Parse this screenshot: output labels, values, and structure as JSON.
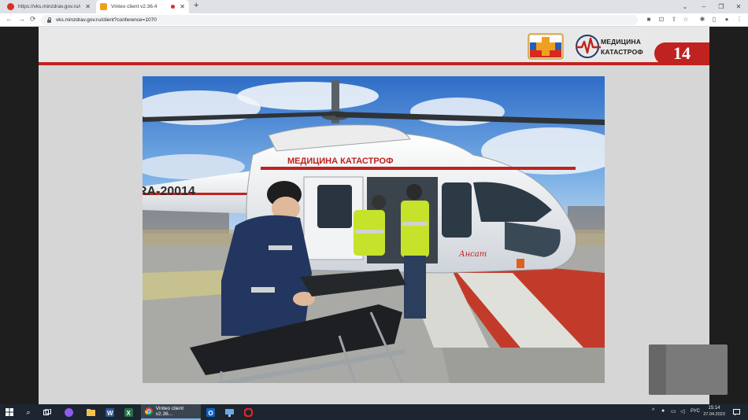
{
  "browser": {
    "tabs": [
      {
        "title": "https://vks.minzdrav.gov.ru/client",
        "active": false,
        "favicon_color": "#d93025"
      },
      {
        "title": "Vinteo client v2.36.4",
        "active": true,
        "favicon_color": "#f0a020",
        "recording": true
      }
    ],
    "new_tab_label": "+",
    "address": "vks.minzdrav.gov.ru/client?conference=1070",
    "nav": {
      "back": "←",
      "forward": "→",
      "reload": "⟳"
    },
    "window_controls": {
      "chevron": "⌄",
      "minimize": "–",
      "restore": "❐",
      "close": "✕"
    }
  },
  "slide": {
    "brand_line1": "МЕДИЦИНА",
    "brand_line2": "КАТАСТРОФ",
    "slide_number": "14",
    "accent_color": "#c0221f",
    "photo": {
      "helicopter_livery": "МЕДИЦИНА КАТАСТРОФ",
      "tail_number": "RA-20014",
      "model_script": "Ансат"
    }
  },
  "taskbar": {
    "active_app": "Vinteo client v2.36...",
    "tray": {
      "language": "РУС",
      "time": "15:14",
      "date": "27.04.2023"
    }
  }
}
